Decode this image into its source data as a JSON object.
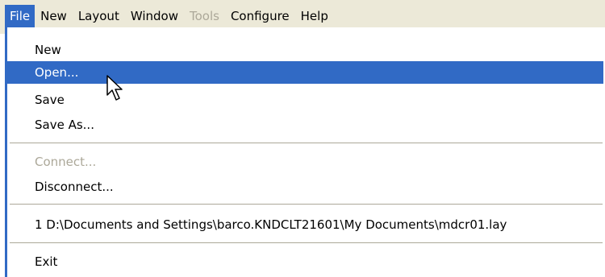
{
  "menubar": {
    "items": [
      {
        "label": "File"
      },
      {
        "label": "New"
      },
      {
        "label": "Layout"
      },
      {
        "label": "Window"
      },
      {
        "label": "Tools"
      },
      {
        "label": "Configure"
      },
      {
        "label": "Help"
      }
    ]
  },
  "file_menu": {
    "items": [
      {
        "label": "New"
      },
      {
        "label": "Open..."
      },
      {
        "label": "Save"
      },
      {
        "label": "Save As..."
      },
      {
        "label": "Connect..."
      },
      {
        "label": "Disconnect..."
      },
      {
        "label": "1 D:\\Documents and Settings\\barco.KNDCLT21601\\My Documents\\mdcr01.lay"
      },
      {
        "label": "Exit"
      }
    ],
    "highlighted": "Open...",
    "disabled": [
      "Connect..."
    ]
  },
  "colors": {
    "highlight": "#316ac5",
    "menu_background": "#ece9d8",
    "disabled_text": "#aca899"
  },
  "icons": {
    "cursor": "mouse-pointer-icon"
  }
}
